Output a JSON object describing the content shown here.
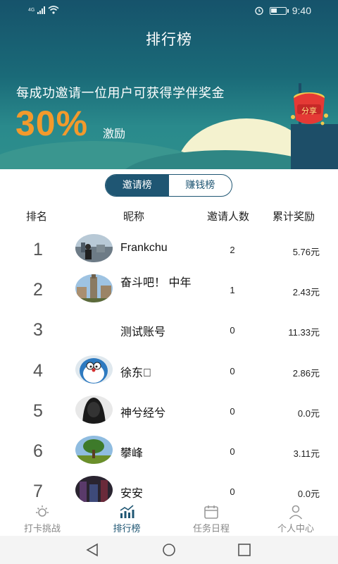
{
  "status_bar": {
    "network": "4G",
    "time": "9:40"
  },
  "header": {
    "title": "排行榜"
  },
  "banner": {
    "line": "每成功邀请一位用户可获得学伴奖金",
    "percent": "30%",
    "suffix": "激励",
    "share_label": "分享"
  },
  "tabs": [
    {
      "label": "邀请榜",
      "active": true
    },
    {
      "label": "赚钱榜",
      "active": false
    }
  ],
  "table": {
    "headers": {
      "rank": "排名",
      "nickname": "昵称",
      "invites": "邀请人数",
      "reward": "累计奖励"
    },
    "rows": [
      {
        "rank": "1",
        "nickname": "Frankchu",
        "invites": "2",
        "reward": "5.76元",
        "avatar": "photo-city-icon"
      },
      {
        "rank": "2",
        "nickname": "奋斗吧！ 中年",
        "invites": "1",
        "reward": "2.43元",
        "avatar": "photo-tower-icon"
      },
      {
        "rank": "3",
        "nickname": "测试账号",
        "invites": "0",
        "reward": "11.33元",
        "avatar": ""
      },
      {
        "rank": "4",
        "nickname": "徐东\u0000",
        "invites": "0",
        "reward": "2.86元",
        "avatar": "cartoon-avatar-icon"
      },
      {
        "rank": "5",
        "nickname": "神兮经兮",
        "invites": "0",
        "reward": "0.0元",
        "avatar": "black-hood-avatar-icon"
      },
      {
        "rank": "6",
        "nickname": "攀峰",
        "invites": "0",
        "reward": "3.11元",
        "avatar": "tree-avatar-icon"
      },
      {
        "rank": "7",
        "nickname": "安安",
        "invites": "0",
        "reward": "0.0元",
        "avatar": "dark-photo-avatar-icon"
      }
    ]
  },
  "bottom_nav": [
    {
      "label": "打卡挑战",
      "icon": "sun-icon",
      "active": false
    },
    {
      "label": "排行榜",
      "icon": "chart-icon",
      "active": true
    },
    {
      "label": "任务日程",
      "icon": "calendar-icon",
      "active": false
    },
    {
      "label": "个人中心",
      "icon": "person-icon",
      "active": false
    }
  ],
  "colors": {
    "banner": "#1a6a78",
    "accent": "#f39a2c",
    "primary": "#1f5673"
  }
}
